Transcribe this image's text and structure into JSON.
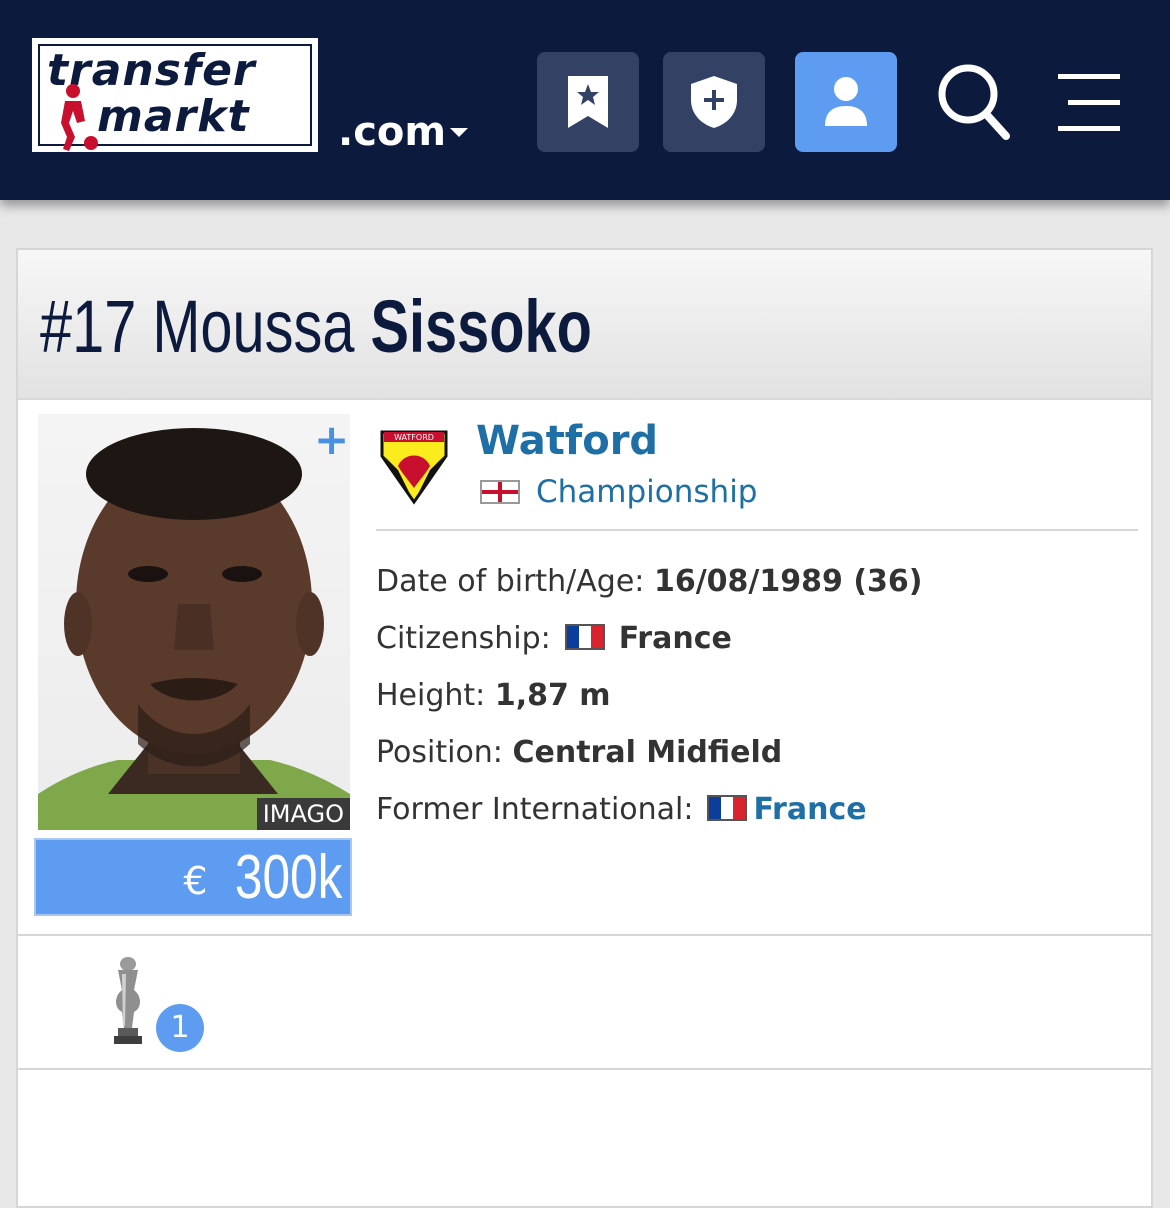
{
  "header": {
    "logo_line1": "transfer",
    "logo_line2": "markt",
    "domain": ".com",
    "buttons": [
      {
        "name": "bookmarks",
        "icon": "bookmark-star-icon"
      },
      {
        "name": "club",
        "icon": "shield-plus-icon"
      },
      {
        "name": "profile",
        "icon": "user-icon",
        "active": true
      }
    ],
    "search_icon": "search-icon",
    "menu_icon": "hamburger-menu-icon"
  },
  "player": {
    "number": "#17",
    "first_name": "Moussa",
    "last_name": "Sissoko",
    "photo_credit": "IMAGO",
    "add_label": "+",
    "market_value_currency": "€",
    "market_value_amount": "300k"
  },
  "club": {
    "name": "Watford",
    "league": "Championship"
  },
  "info": {
    "dob_label": "Date of birth/Age:",
    "dob_value": "16/08/1989 (36)",
    "citizenship_label": "Citizenship:",
    "citizenship_value": "France",
    "height_label": "Height:",
    "height_value": "1,87 m",
    "position_label": "Position:",
    "position_value": "Central Midfield",
    "former_intl_label": "Former International:",
    "former_intl_value": "France"
  },
  "trophies": {
    "count": "1"
  },
  "colors": {
    "header_bg": "#0c1a3d",
    "accent": "#5d9cf0",
    "link": "#1d6fa5"
  }
}
